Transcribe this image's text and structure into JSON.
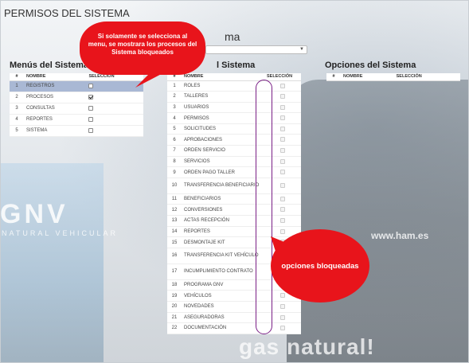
{
  "page_title": "PERMISOS DEL SISTEMA",
  "hidden_title_fragment": "ma",
  "sections": {
    "menus": "Menús del Sistema",
    "procesos": "l Sistema",
    "opciones": "Opciones del Sistema"
  },
  "columns": {
    "num": "#",
    "nombre": "NOMBRE",
    "seleccion": "SELECCIÓN"
  },
  "menus": [
    {
      "n": "1",
      "name": "REGISTROS",
      "checked": false,
      "selected": true
    },
    {
      "n": "2",
      "name": "PROCESOS",
      "checked": true,
      "selected": false
    },
    {
      "n": "3",
      "name": "CONSULTAS",
      "checked": false,
      "selected": false
    },
    {
      "n": "4",
      "name": "REPORTES",
      "checked": false,
      "selected": false
    },
    {
      "n": "5",
      "name": "SISTEMA",
      "checked": false,
      "selected": false
    }
  ],
  "procesos": [
    {
      "n": "1",
      "name": "ROLES"
    },
    {
      "n": "2",
      "name": "TALLERES"
    },
    {
      "n": "3",
      "name": "USUARIOS"
    },
    {
      "n": "4",
      "name": "PERMISOS"
    },
    {
      "n": "5",
      "name": "SOLICITUDES"
    },
    {
      "n": "6",
      "name": "APROBACIONES"
    },
    {
      "n": "7",
      "name": "ORDEN SERVICIO"
    },
    {
      "n": "8",
      "name": "SERVICIOS"
    },
    {
      "n": "9",
      "name": "ORDEN PAGO TALLER"
    },
    {
      "n": "10",
      "name": "TRANSFERENCIA BENEFICIARIO"
    },
    {
      "n": "11",
      "name": "BENEFICIARIOS"
    },
    {
      "n": "12",
      "name": "CONVERSIONES"
    },
    {
      "n": "13",
      "name": "ACTAS RECEPCIÓN"
    },
    {
      "n": "14",
      "name": "REPORTES"
    },
    {
      "n": "15",
      "name": "DESMONTAJE KIT"
    },
    {
      "n": "16",
      "name": "TRANSFERENCIA KIT VEHÍCULO"
    },
    {
      "n": "17",
      "name": "INCUMPLIMIENTO CONTRATO"
    },
    {
      "n": "18",
      "name": "PROGRAMA GNV"
    },
    {
      "n": "19",
      "name": "VEHÍCULOS"
    },
    {
      "n": "20",
      "name": "NOVEDADES"
    },
    {
      "n": "21",
      "name": "ASEGURADORAS"
    },
    {
      "n": "22",
      "name": "DOCUMENTACIÓN"
    }
  ],
  "callouts": {
    "menu_note": "Si solamente se selecciona al menu, se mostrara los procesos del Sistema bloqueados",
    "blocked": "opciones bloqueadas"
  },
  "background_text": {
    "gnv": "GNV",
    "gnv_sub": "NATURAL VEHICULAR",
    "ham": "www.ham.es",
    "van": "gas natural!"
  },
  "colors": {
    "callout": "#e8141b",
    "oval": "#7a1f86",
    "selected_row": "#a9b8d4"
  }
}
